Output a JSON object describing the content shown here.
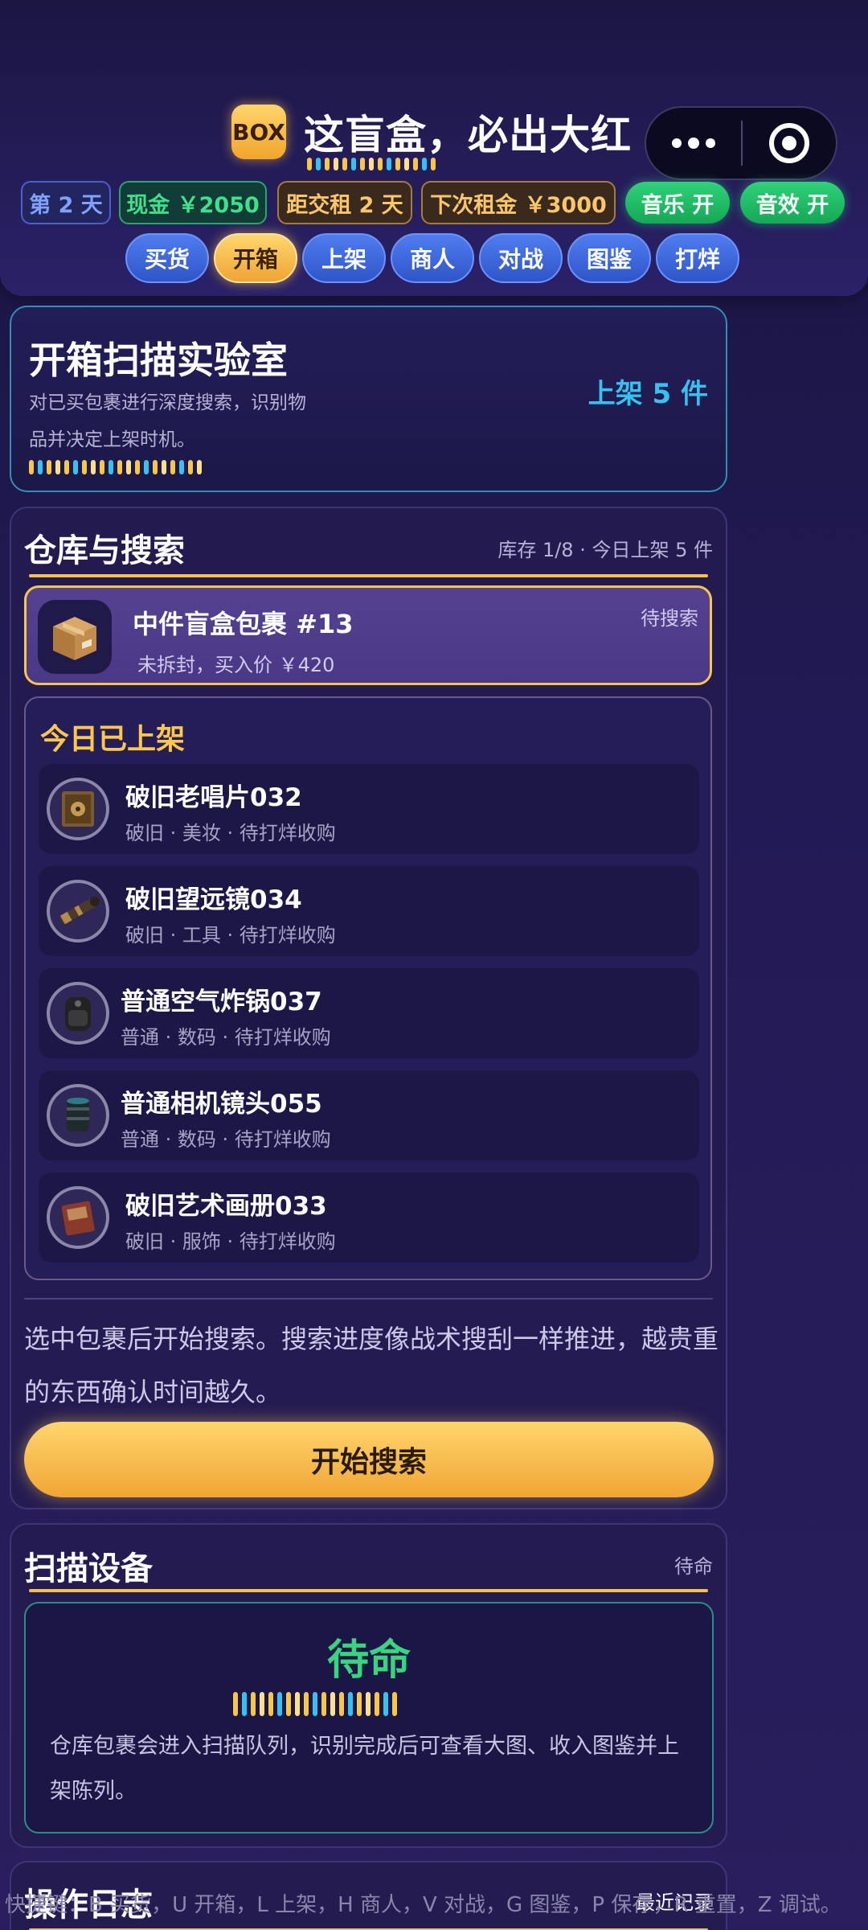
{
  "header": {
    "logo_text": "BOX",
    "title": "这盲盒，必出大红",
    "stats": {
      "day": "第 2 天",
      "cash": "现金 ￥2050",
      "rent_due": "距交租 2 天",
      "next_rent": "下次租金 ￥3000"
    },
    "toggles": {
      "music": "音乐 开",
      "sfx": "音效 开"
    },
    "tabs": [
      "买货",
      "开箱",
      "上架",
      "商人",
      "对战",
      "图鉴",
      "打烊"
    ],
    "active_tab": "开箱"
  },
  "hero": {
    "title": "开箱扫描实验室",
    "description": "对已买包裹进行深度搜索，识别物品并决定上架时机。",
    "badge": "上架 5 件"
  },
  "storage": {
    "title": "仓库与搜索",
    "meta": "库存 1/8 · 今日上架 5 件",
    "package": {
      "name": "中件盲盒包裹 #13",
      "status": "待搜索",
      "subtitle": "未拆封，买入价 ￥420"
    },
    "shelved_title": "今日已上架",
    "shelved_items": [
      {
        "name": "破旧老唱片032",
        "meta": "破旧 · 美妆 · 待打烊收购",
        "icon": "record-icon"
      },
      {
        "name": "破旧望远镜034",
        "meta": "破旧 · 工具 · 待打烊收购",
        "icon": "telescope-icon"
      },
      {
        "name": "普通空气炸锅037",
        "meta": "普通 · 数码 · 待打烊收购",
        "icon": "air-fryer-icon"
      },
      {
        "name": "普通相机镜头055",
        "meta": "普通 · 数码 · 待打烊收购",
        "icon": "camera-lens-icon"
      },
      {
        "name": "破旧艺术画册033",
        "meta": "破旧 · 服饰 · 待打烊收购",
        "icon": "art-book-icon"
      }
    ],
    "description": "选中包裹后开始搜索。搜索进度像战术搜刮一样推进，越贵重的东西确认时间越久。",
    "search_button": "开始搜索"
  },
  "scanner": {
    "title": "扫描设备",
    "meta": "待命",
    "state": "待命",
    "description": "仓库包裹会进入扫描队列，识别完成后可查看大图、收入图鉴并上架陈列。"
  },
  "log": {
    "title": "操作日志",
    "meta": "最近记录"
  },
  "footer_hint": "快捷键：B 买货，U 开箱，L 上架，H 商人，V 对战，G 图鉴，P 保存，R 重置，Z 调试。",
  "colors": {
    "accent_gold": "#f7c64a",
    "accent_cyan": "#36c2ef",
    "accent_green": "#37d57d",
    "tab_blue": "#3f67dc"
  }
}
